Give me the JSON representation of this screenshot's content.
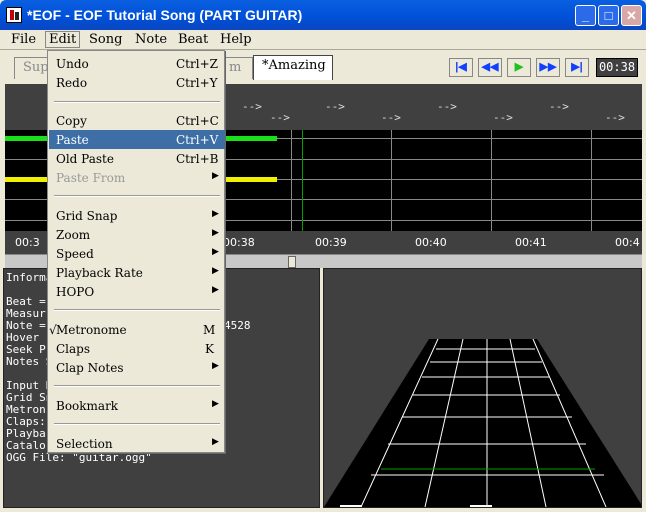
{
  "window": {
    "title": "*EOF - EOF Tutorial Song (PART GUITAR)",
    "minimize": "_",
    "maximize": "□",
    "close": "✕"
  },
  "menubar": [
    "File",
    "Edit",
    "Song",
    "Note",
    "Beat",
    "Help"
  ],
  "tabs": {
    "left_partial": "Sup",
    "mid_partial": "m",
    "active": "*Amazing"
  },
  "transport": {
    "rewind_start": "|◀",
    "rewind": "◀◀",
    "play": "▶",
    "forward": "▶▶",
    "forward_end": "▶|",
    "time": "00:38"
  },
  "beats": {
    "arrows": [
      "-->",
      "-->",
      "-->",
      "-->",
      "-->",
      "-->",
      "-->",
      "-->"
    ]
  },
  "timeline": [
    "00:3",
    "00:38",
    "00:39",
    "00:40",
    "00:41",
    "00:4"
  ],
  "colors": {
    "note_green": "#19e019",
    "note_yellow": "#f0f000",
    "marker_green": "#00a000",
    "highlight": "#3d6ea5"
  },
  "info": {
    "lines": [
      "Informa",
      "",
      "Beat =",
      "Measur",
      "Note =",
      "Hover",
      "Seek P",
      "Notes S",
      "",
      "Input N",
      "Grid Sn",
      "Metron",
      "Claps:",
      "Playba",
      "Catalo",
      "OGG File: \"guitar.ogg\""
    ],
    "note_value_tail": "4528"
  },
  "edit_menu": {
    "items": [
      {
        "label": "Undo",
        "shortcut": "Ctrl+Z"
      },
      {
        "label": "Redo",
        "shortcut": "Ctrl+Y"
      },
      {
        "label": "Copy",
        "shortcut": "Ctrl+C"
      },
      {
        "label": "Paste",
        "shortcut": "Ctrl+V"
      },
      {
        "label": "Old Paste",
        "shortcut": "Ctrl+B"
      },
      {
        "label": "Paste From",
        "submenu": "▶"
      },
      {
        "label": "Grid Snap",
        "submenu": "▶"
      },
      {
        "label": "Zoom",
        "submenu": "▶"
      },
      {
        "label": "Speed",
        "submenu": "▶"
      },
      {
        "label": "Playback Rate",
        "submenu": "▶"
      },
      {
        "label": "HOPO",
        "submenu": "▶"
      },
      {
        "label": "Metronome",
        "shortcut": "M",
        "check": "√"
      },
      {
        "label": "Claps",
        "shortcut": "K"
      },
      {
        "label": "Clap Notes",
        "submenu": "▶"
      },
      {
        "label": "Bookmark",
        "submenu": "▶"
      },
      {
        "label": "Selection",
        "submenu": "▶"
      }
    ]
  }
}
